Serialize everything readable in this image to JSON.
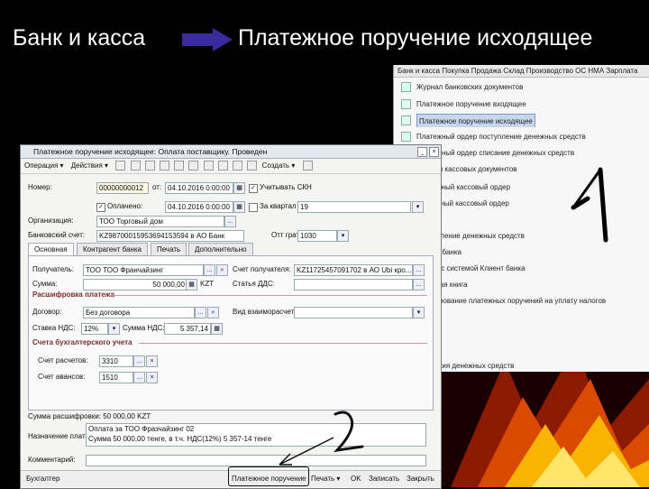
{
  "slide": {
    "left_title": "Банк и касса",
    "right_title": "Платежное поручение исходящее"
  },
  "bg_window": {
    "menubar": "Банк и касса  Покупка  Продажа  Склад  Производство  ОС  НМА  Зарплата",
    "items": [
      {
        "label": "Журнал банковских документов",
        "selected": false
      },
      {
        "label": "Платежное поручение входящее",
        "selected": false
      },
      {
        "label": "Платежное поручение исходящее",
        "selected": true
      },
      {
        "label": "Платежный ордер поступление денежных средств",
        "selected": false
      },
      {
        "label": "Платежный ордер списание денежных средств",
        "selected": false
      },
      {
        "label": "Журнал кассовых документов",
        "selected": false
      },
      {
        "label": "Приходный кассовый ордер",
        "selected": false
      },
      {
        "label": "Расходный кассовый ордер",
        "selected": false
      },
      {
        "label": "Поступление денежных средств",
        "selected": false
      },
      {
        "label": "Клиент банка",
        "selected": false
      },
      {
        "label": "Обмен с системой Клиент банка",
        "selected": false
      },
      {
        "label": "Кассовая книга",
        "selected": false
      },
      {
        "label": "Формирование платежных поручений на уплату налогов",
        "selected": false
      },
      {
        "label": "Движения денежных средств",
        "selected": false
      }
    ]
  },
  "annotations": {
    "one": "1",
    "two": "2"
  },
  "doc": {
    "title": "Платежное поручение исходящее: Оплата поставщику. Проведен",
    "toolbar": [
      "Операция ▾",
      "Действия ▾",
      "Создать ▾"
    ],
    "number_label": "Номер:",
    "number_value": "00000000012",
    "date_label": "от:",
    "date_value": "04.10.2016 0:00:00",
    "vat_label": "Учитывать СКН",
    "paid_label": "Оплачено:",
    "paid_value": "04.10.2016 0:00:00",
    "quarter_label": "За квартал 19:",
    "quarter_value": "19",
    "org_label": "Организация:",
    "org_value": "ТОО Торговый дом",
    "bank_label": "Банковский счет:",
    "bank_value": "KZ98700015953694153594 в АО Банк",
    "kbe_label": "Отт грата:",
    "kbe_value": "1030",
    "tabs": [
      "Основная",
      "Контрагент банка",
      "Печать",
      "Дополнительно"
    ],
    "recipient_label": "Получатель:",
    "recipient_value": "ТОО ТОО Франчайзинг",
    "recipient_acc_label": "Счет получателя:",
    "recipient_acc_value": "KZ11725457091702 в АО Ubi кро...",
    "sum_label": "Сумма:",
    "sum_value": "50 000,00",
    "currency": "KZT",
    "dds_label": "Статья ДДС:",
    "section1": "Расшифровка платежа",
    "contract_label": "Договор:",
    "contract_value": "Без договора",
    "settle_label": "Вид взаиморасчетов:",
    "vat_rate_label": "Ставка НДС:",
    "vat_rate_value": "12%",
    "vat_sum_label": "Сумма НДС:",
    "vat_sum_value": "5 357,14",
    "section2": "Счета бухгалтерского учета",
    "acc1_label": "Счет расчетов:",
    "acc1_value": "3310",
    "acc2_label": "Счет авансов:",
    "acc2_value": "1510",
    "total_line": "Сумма расшифровки: 50 000,00 KZT",
    "purpose_label": "Назначение платежа:",
    "purpose_value": "Оплата за ТОО Фразчайзинг 02\nСумма 50 000,00 тенге, в т.ч. НДС(12%) 5 357-14 тенге",
    "comment_label": "Комментарий:",
    "status_author": "Бухгалтер",
    "status_btns": [
      "Платежное поручение",
      "Печать ▾",
      "OK",
      "Записать",
      "Закрыть"
    ]
  }
}
